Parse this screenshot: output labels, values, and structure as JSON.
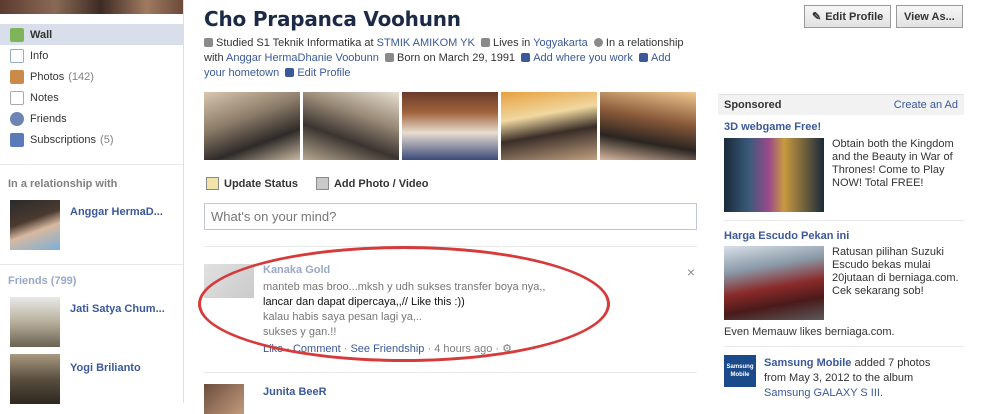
{
  "left_nav": {
    "items": [
      {
        "label": "Wall",
        "count": ""
      },
      {
        "label": "Info",
        "count": ""
      },
      {
        "label": "Photos",
        "count": "(142)"
      },
      {
        "label": "Notes",
        "count": ""
      },
      {
        "label": "Friends",
        "count": ""
      },
      {
        "label": "Subscriptions",
        "count": "(5)"
      }
    ],
    "relationship_heading": "In a relationship with",
    "relationship_partner": "Anggar HermaD...",
    "friends_heading": "Friends (799)",
    "friends": [
      "Jati Satya Chum...",
      "Yogi Brilianto"
    ]
  },
  "profile": {
    "name": "Cho Prapanca Voohunn",
    "studied_prefix": "Studied S1 Teknik Informatika at",
    "school": "STMIK AMIKOM YK",
    "lives_prefix": "Lives in",
    "city": "Yogyakarta",
    "relationship_prefix": "In a relationship with",
    "partner": "Anggar HermaDhanie Voobunn",
    "born": "Born on March 29, 1991",
    "add_work": "Add where you work",
    "add_hometown": "Add your hometown",
    "edit_profile": "Edit Profile"
  },
  "header_buttons": {
    "edit_profile": "Edit Profile",
    "view_as": "View As..."
  },
  "composer": {
    "update_status": "Update Status",
    "add_photo": "Add Photo / Video",
    "placeholder": "What's on your mind?"
  },
  "feed": [
    {
      "author": "Kanaka Gold",
      "lines": [
        "manteb mas broo...mksh y udh sukses transfer boya nya,,",
        "lancar dan dapat dipercaya,,// Like this :))",
        "kalau habis saya pesan lagi ya,..",
        "sukses y gan.!!"
      ],
      "like": "Like",
      "comment": "Comment",
      "see_friendship": "See Friendship",
      "time": "4 hours ago",
      "close": "×"
    },
    {
      "author": "Junita BeeR"
    }
  ],
  "sponsored": {
    "heading": "Sponsored",
    "create_ad": "Create an Ad",
    "ads": [
      {
        "title": "3D webgame Free!",
        "text": "Obtain both the Kingdom and the Beauty in War of Thrones! Come to Play NOW! Total FREE!"
      },
      {
        "title": "Harga Escudo Pekan ini",
        "text": "Ratusan pilihan Suzuki Escudo bekas mulai 20jutaan di berniaga.com. Cek sekarang sob!",
        "social": "Even Memauw likes berniaga.com."
      }
    ],
    "samsung": {
      "name": "Samsung Mobile",
      "logo_text": "Samsung Mobile",
      "text_1": "added 7 photos",
      "text_2": "from May 3, 2012 to the album",
      "album": "Samsung GALAXY S III."
    }
  },
  "colors": {
    "link": "#3b5998",
    "highlight_oval": "#d63a3a",
    "nav_active_bg": "#d8dfea"
  }
}
